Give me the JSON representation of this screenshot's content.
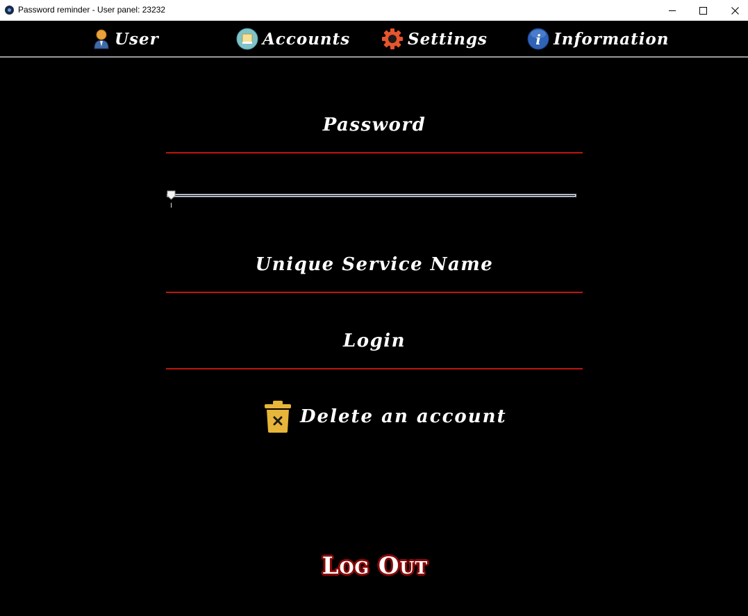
{
  "window": {
    "title": "Password reminder - User panel: 23232",
    "minimize_icon": "minimize-icon",
    "maximize_icon": "maximize-icon",
    "close_icon": "close-icon"
  },
  "menu": {
    "items": [
      {
        "label": "User",
        "icon": "user-icon"
      },
      {
        "label": "Accounts",
        "icon": "accounts-icon"
      },
      {
        "label": "Settings",
        "icon": "gear-icon"
      },
      {
        "label": "Information",
        "icon": "info-icon"
      }
    ]
  },
  "form": {
    "password_label": "Password",
    "slider_value": 0,
    "service_label": "Unique Service Name",
    "login_label": "Login",
    "delete_label": "Delete an account",
    "delete_icon": "trash-icon"
  },
  "logout_label": "Log Out",
  "colors": {
    "background": "#000000",
    "accent_line": "#c0150f",
    "logout_outline": "#8a0a0a",
    "trash": "#e7b53a"
  }
}
